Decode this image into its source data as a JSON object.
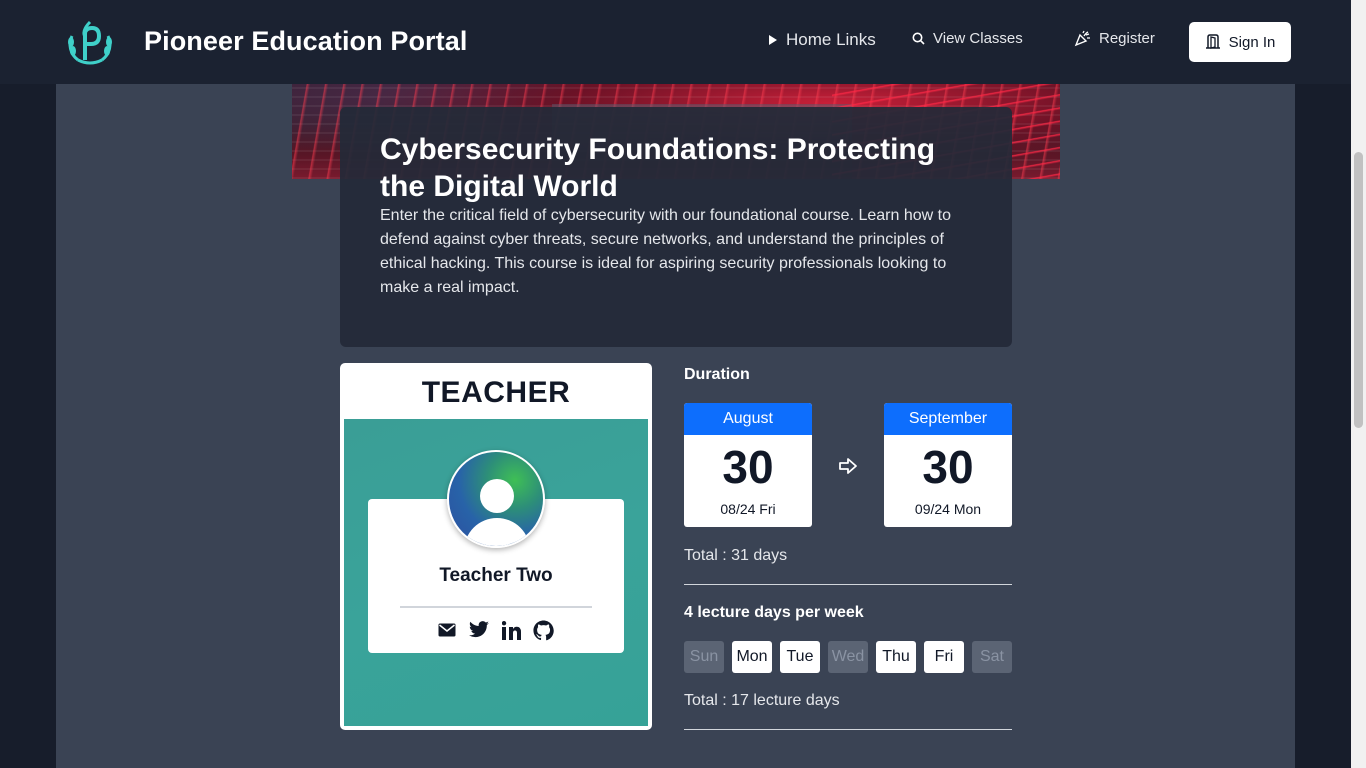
{
  "header": {
    "brand": "Pioneer Education Portal",
    "logo_icon": "laurel-p-logo-icon",
    "nav": {
      "home_links": "Home Links",
      "view_classes": "View Classes",
      "register": "Register",
      "sign_in": "Sign In"
    }
  },
  "course": {
    "title": "Cybersecurity Foundations: Protecting the Digital World",
    "description": "Enter the critical field of cybersecurity with our foundational course. Learn how to defend against cyber threats, secure networks, and understand the principles of ethical hacking. This course is ideal for aspiring security professionals looking to make a real impact."
  },
  "teacher": {
    "heading": "TEACHER",
    "name": "Teacher Two",
    "socials": [
      "mail-icon",
      "twitter-icon",
      "linkedin-icon",
      "github-icon"
    ]
  },
  "duration": {
    "label": "Duration",
    "start": {
      "month": "August",
      "day": "30",
      "sub": "08/24 Fri"
    },
    "end": {
      "month": "September",
      "day": "30",
      "sub": "09/24 Mon"
    },
    "total": "Total : 31 days"
  },
  "lectures": {
    "label": "4 lecture days per week",
    "days": [
      {
        "label": "Sun",
        "active": false
      },
      {
        "label": "Mon",
        "active": true
      },
      {
        "label": "Tue",
        "active": true
      },
      {
        "label": "Wed",
        "active": false
      },
      {
        "label": "Thu",
        "active": true
      },
      {
        "label": "Fri",
        "active": true
      },
      {
        "label": "Sat",
        "active": false
      }
    ],
    "total": "Total : 17 lecture days"
  },
  "colors": {
    "accent": "#0d6efd",
    "teal": "#3aa39a",
    "nav_bg": "#1b2231",
    "page_bg": "#3a4354"
  }
}
